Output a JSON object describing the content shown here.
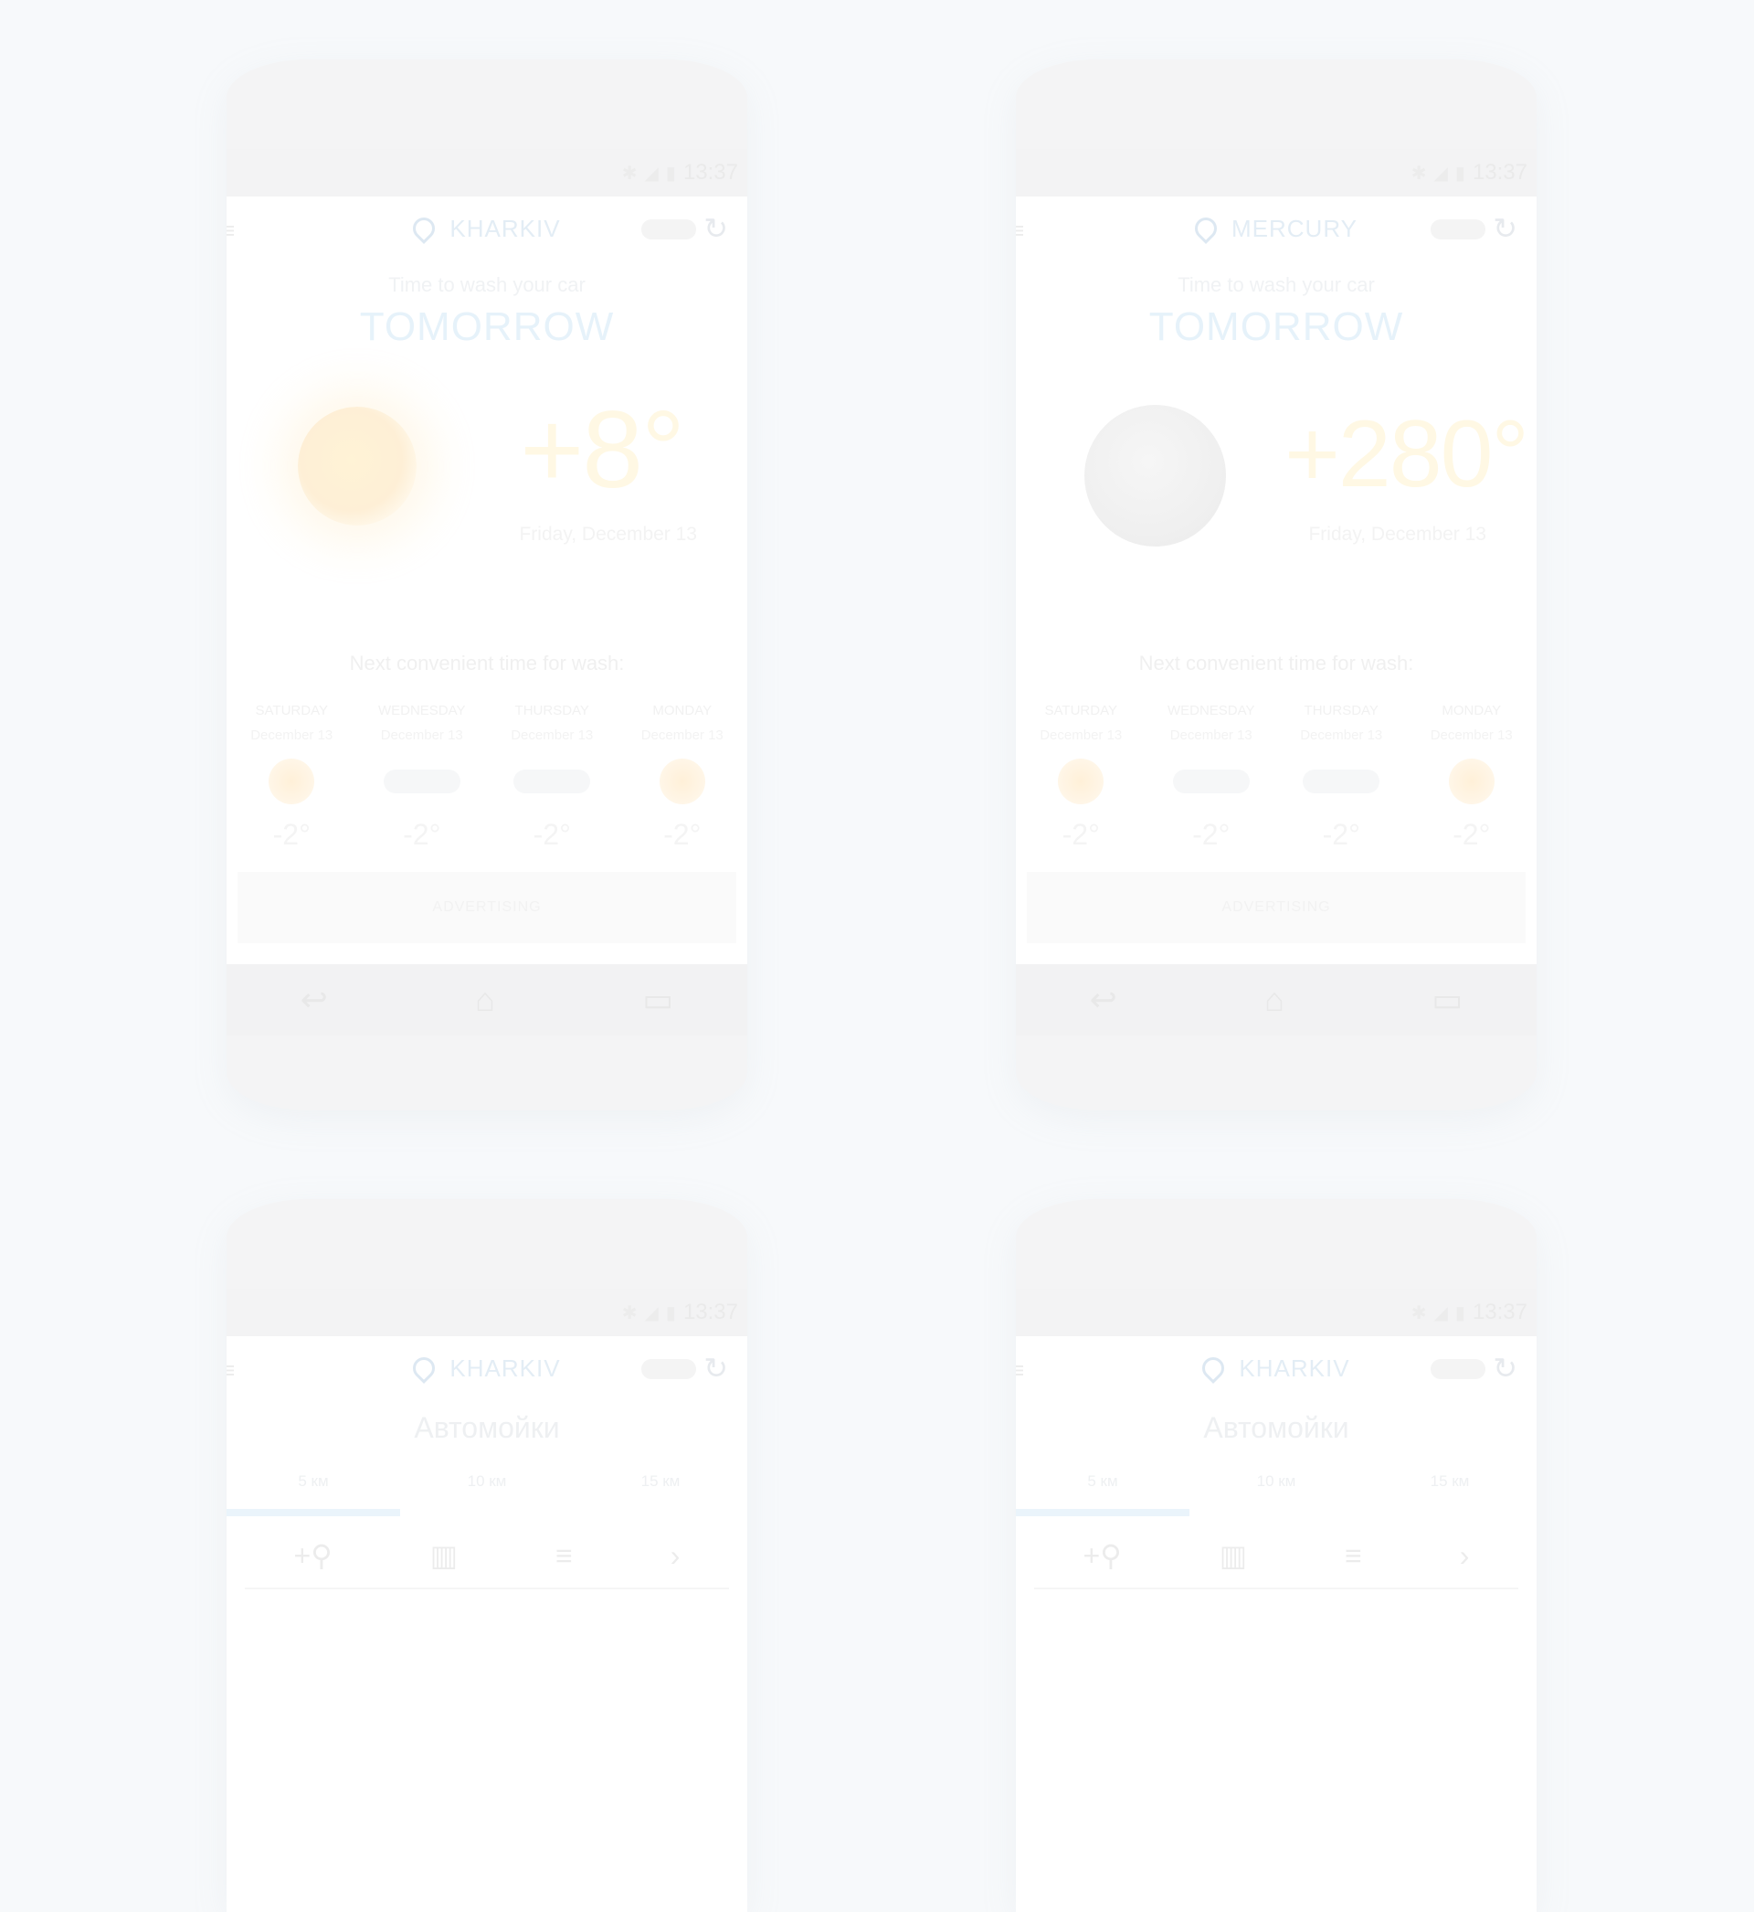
{
  "status_time": "13:37",
  "phones": [
    {
      "city": "KHARKIV",
      "subtitle": "Time to wash your car",
      "headline": "TOMORROW",
      "temp": "+8°",
      "date": "Friday, December 13",
      "next": "Next convenient time for wash:",
      "days": [
        {
          "name": "SATURDAY",
          "date": "December 13",
          "temp": "-2°",
          "icon": "sun-icon"
        },
        {
          "name": "WEDNESDAY",
          "date": "December 13",
          "temp": "-2°",
          "icon": "sun-cloud-icon"
        },
        {
          "name": "THURSDAY",
          "date": "December 13",
          "temp": "-2°",
          "icon": "cloud-icon"
        },
        {
          "name": "MONDAY",
          "date": "December 13",
          "temp": "-2°",
          "icon": "sun-icon"
        }
      ],
      "ad": "ADVERTISING"
    },
    {
      "city": "MERCURY",
      "subtitle": "Time to wash your car",
      "headline": "TOMORROW",
      "temp": "+280°",
      "date": "Friday, December 13",
      "next": "Next convenient time for wash:",
      "days": [
        {
          "name": "SATURDAY",
          "date": "December 13",
          "temp": "-2°",
          "icon": "sun-icon"
        },
        {
          "name": "WEDNESDAY",
          "date": "December 13",
          "temp": "-2°",
          "icon": "sun-cloud-icon"
        },
        {
          "name": "THURSDAY",
          "date": "December 13",
          "temp": "-2°",
          "icon": "cloud-icon"
        },
        {
          "name": "MONDAY",
          "date": "December 13",
          "temp": "-2°",
          "icon": "sun-icon"
        }
      ],
      "ad": "ADVERTISING"
    },
    {
      "city": "KHARKIV",
      "title": "Автомойки",
      "tabs": [
        "5 км",
        "10 км",
        "15 км"
      ]
    },
    {
      "city": "KHARKIV",
      "title": "Автомойки",
      "tabs": [
        "5 км",
        "10 км",
        "15 км"
      ]
    }
  ],
  "toolbar_icons": [
    "add-location-icon",
    "map-icon",
    "list-icon",
    "chevron-right-icon"
  ],
  "nav_icons": [
    "back-icon",
    "home-icon",
    "recents-icon"
  ]
}
